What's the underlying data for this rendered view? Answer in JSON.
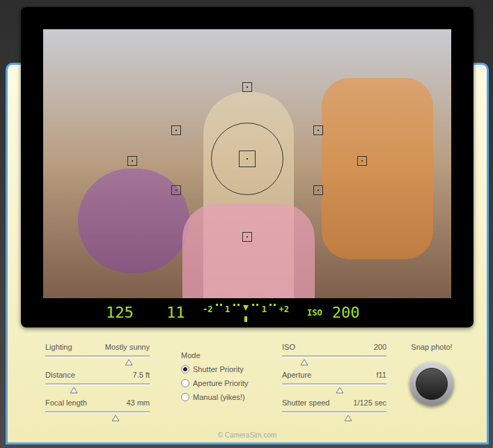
{
  "viewfinder": {
    "photo": "blurred playground portrait"
  },
  "lcd": {
    "shutter": "125",
    "aperture": "11",
    "meter": {
      "labels": [
        "-2",
        "1",
        "1",
        "+2"
      ],
      "level": 0.5
    },
    "iso_label": "ISO",
    "iso": "200"
  },
  "left_sliders": [
    {
      "label": "Lighting",
      "value": "Mostly sunny",
      "level": 0.8
    },
    {
      "label": "Distance",
      "value": "7.5 ft",
      "level": 0.27
    },
    {
      "label": "Focal length",
      "value": "43 mm",
      "level": 0.67
    }
  ],
  "mode": {
    "label": "Mode",
    "options": [
      {
        "label": "Shutter Priority",
        "selected": true
      },
      {
        "label": "Aperture Priority",
        "selected": false
      },
      {
        "label": "Manual (yikes!)",
        "selected": false
      }
    ]
  },
  "right_sliders": [
    {
      "label": "ISO",
      "value": "200",
      "level": 0.21
    },
    {
      "label": "Aperture",
      "value": "f11",
      "level": 0.55
    },
    {
      "label": "Shutter speed",
      "value": "1/125 sec",
      "level": 0.63
    }
  ],
  "snap": {
    "label": "Snap photo!"
  },
  "footer": "© CameraSim.com"
}
